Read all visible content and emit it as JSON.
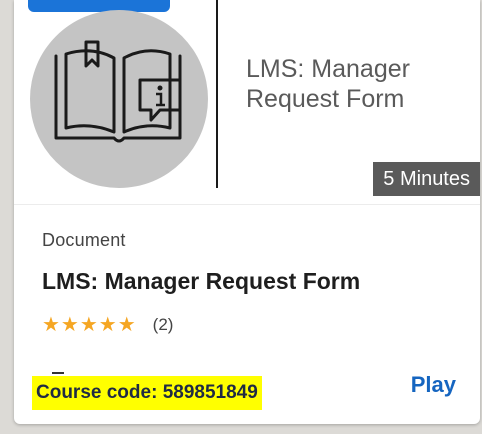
{
  "thumbnail": {
    "title": "LMS: Manager\nRequest Form",
    "duration": "5 Minutes",
    "icon": "book-info-icon"
  },
  "card": {
    "type_label": "Document",
    "title": "LMS: Manager Request Form",
    "stars": "★★★★★",
    "rating": 5,
    "review_count": "(2)",
    "course_code": "Course code: 589851849",
    "play_label": "Play"
  },
  "colors": {
    "accent": "#1565c0",
    "star": "#f5a623",
    "highlight": "#ffff00",
    "tag": "#1b74d8"
  }
}
